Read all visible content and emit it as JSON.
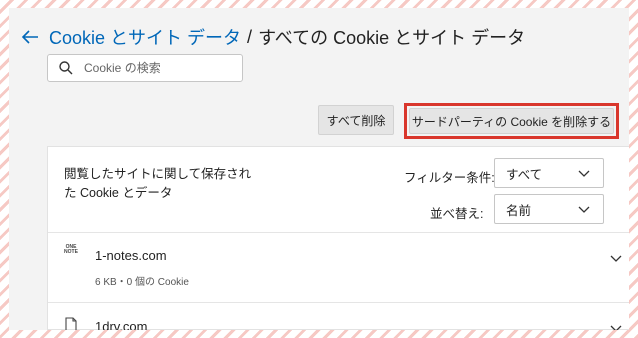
{
  "header": {
    "breadcrumb_parent": "Cookie とサイト データ",
    "breadcrumb_separator": "/",
    "breadcrumb_current": "すべての Cookie とサイト データ"
  },
  "search": {
    "placeholder": "Cookie の検索",
    "value": ""
  },
  "actions": {
    "clear_all_label": "すべて削除",
    "clear_third_party_label": "サードパーティの Cookie を削除する",
    "highlight_color": "#d9362c"
  },
  "card": {
    "title": "閲覧したサイトに関して保存された Cookie とデータ",
    "filter_label": "フィルター条件:",
    "filter_value": "すべて",
    "sort_label": "並べ替え:",
    "sort_value": "名前"
  },
  "sites": [
    {
      "name": "1-notes.com",
      "info": "6 KB・0 個の Cookie",
      "icon": "onenote-icon",
      "icon_text": "ONE NOTE"
    },
    {
      "name": "1drv.com",
      "info": "",
      "icon": "page-icon"
    }
  ],
  "colors": {
    "link": "#0067b8",
    "panel_background": "#f3f3f3"
  }
}
